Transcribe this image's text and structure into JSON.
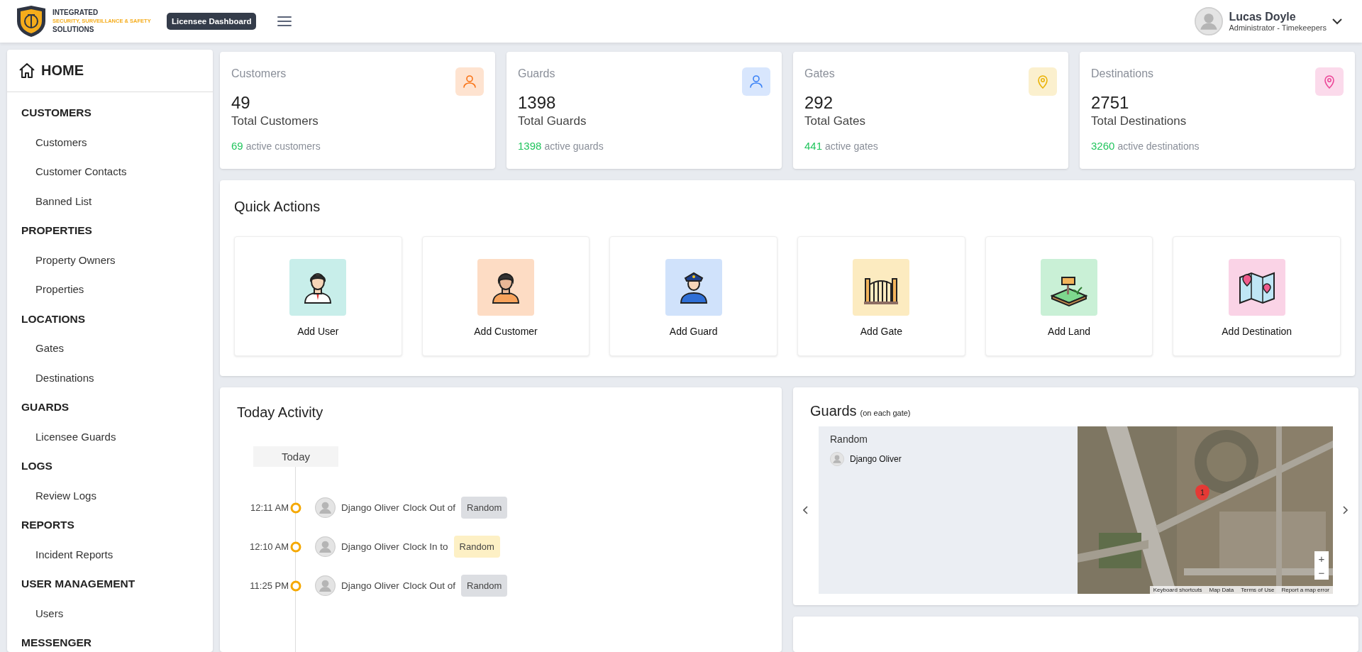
{
  "header": {
    "logo": {
      "line_1": "INTEGRATED",
      "line_2": "SECURITY, SURVEILLANCE & SAFETY",
      "line_3": "SOLUTIONS"
    },
    "badge": "Licensee Dashboard",
    "user": {
      "name": "Lucas Doyle",
      "role": "Administrator - Timekeepers"
    }
  },
  "sidebar": {
    "home": "HOME",
    "sections": [
      {
        "title": "CUSTOMERS",
        "items": [
          {
            "label": "Customers"
          },
          {
            "label": "Customer Contacts"
          },
          {
            "label": "Banned List"
          }
        ]
      },
      {
        "title": "PROPERTIES",
        "items": [
          {
            "label": "Property Owners"
          },
          {
            "label": "Properties"
          }
        ]
      },
      {
        "title": "LOCATIONS",
        "items": [
          {
            "label": "Gates"
          },
          {
            "label": "Destinations"
          }
        ]
      },
      {
        "title": "GUARDS",
        "items": [
          {
            "label": "Licensee Guards"
          }
        ]
      },
      {
        "title": "LOGS",
        "items": [
          {
            "label": "Review Logs"
          }
        ]
      },
      {
        "title": "REPORTS",
        "items": [
          {
            "label": "Incident Reports"
          }
        ]
      },
      {
        "title": "USER MANAGEMENT",
        "items": [
          {
            "label": "Users"
          }
        ]
      },
      {
        "title": "MESSENGER"
      }
    ]
  },
  "stats": [
    {
      "title": "Customers",
      "kind": "person",
      "color": "#f97316",
      "value": "49",
      "label": "Total Customers",
      "active_count": "69",
      "active_label": "active customers"
    },
    {
      "title": "Guards",
      "kind": "person",
      "color": "#3b82f6",
      "value": "1398",
      "label": "Total Guards",
      "active_count": "1398",
      "active_label": "active guards"
    },
    {
      "title": "Gates",
      "kind": "pin",
      "color": "#eab308",
      "value": "292",
      "label": "Total Gates",
      "active_count": "441",
      "active_label": "active gates"
    },
    {
      "title": "Destinations",
      "kind": "pin",
      "color": "#ec4899",
      "value": "2751",
      "label": "Total Destinations",
      "active_count": "3260",
      "active_label": "active destinations"
    }
  ],
  "quick_actions": {
    "title": "Quick Actions",
    "items": [
      {
        "label": "Add User",
        "kind": "user",
        "color": "#c8eeea"
      },
      {
        "label": "Add Customer",
        "kind": "customer",
        "color": "#fddcc4"
      },
      {
        "label": "Add Guard",
        "kind": "guard",
        "color": "#d0e2fb"
      },
      {
        "label": "Add Gate",
        "kind": "gate",
        "color": "#fcebc0"
      },
      {
        "label": "Add Land",
        "kind": "land",
        "color": "#c9f0d6"
      },
      {
        "label": "Add Destination",
        "kind": "destination",
        "color": "#fad3e6"
      }
    ]
  },
  "today_activity": {
    "title": "Today Activity",
    "day": "Today",
    "events": [
      {
        "time": "12:11 AM",
        "name": "Django Oliver",
        "action": "Clock Out of",
        "gate": "Random",
        "color": "#dcdee2"
      },
      {
        "time": "12:10 AM",
        "name": "Django Oliver",
        "action": "Clock In to",
        "gate": "Random",
        "color": "#fdf0c5"
      },
      {
        "time": "11:25 PM",
        "name": "Django Oliver",
        "action": "Clock Out of",
        "gate": "Random",
        "color": "#dcdee2"
      }
    ]
  },
  "guards_panel": {
    "title": "Guards",
    "subtitle": "(on each gate)",
    "gate": "Random",
    "guards": [
      {
        "name": "Django Oliver"
      }
    ],
    "map": {
      "kind": "picture",
      "marker": "1",
      "zoom_in": "+",
      "zoom_out": "−",
      "links": [
        "Keyboard shortcuts",
        "Map Data",
        "Terms of Use",
        "Report a map error"
      ]
    }
  }
}
